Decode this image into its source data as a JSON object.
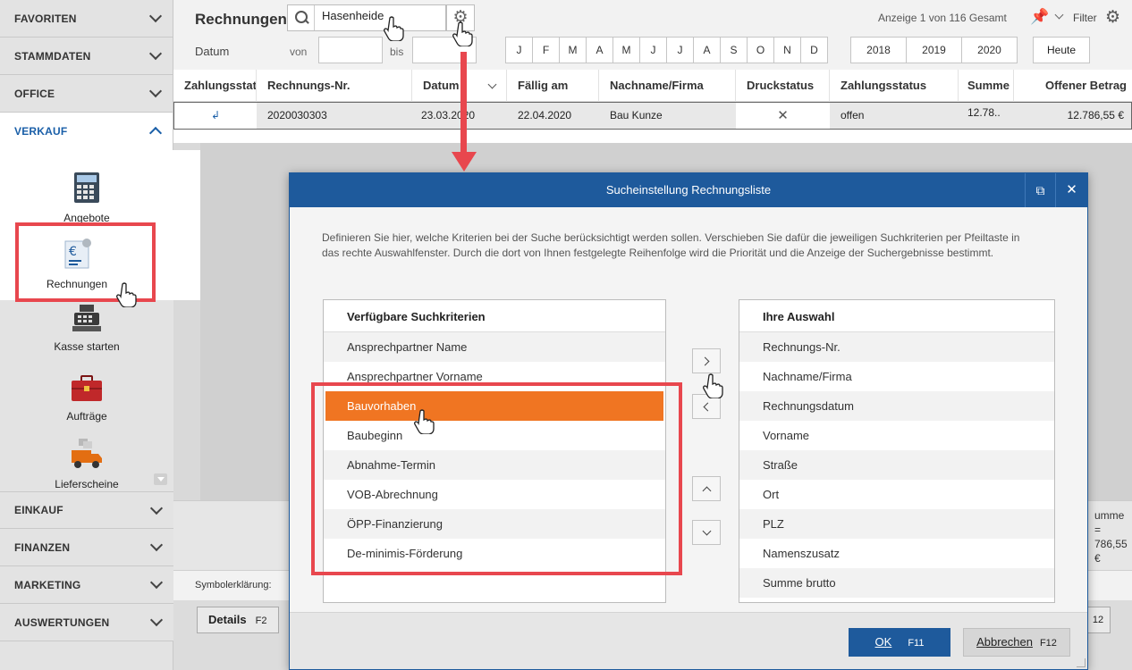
{
  "sidebar": {
    "sections_top": [
      "FAVORITEN",
      "STAMMDATEN",
      "OFFICE"
    ],
    "open_section": "VERKAUF",
    "tiles": [
      {
        "label": "Angebote",
        "icon": "calculator-icon"
      },
      {
        "label": "Rechnungen",
        "icon": "invoice-euro-icon"
      },
      {
        "label": "Kasse starten",
        "icon": "cash-register-icon"
      },
      {
        "label": "Aufträge",
        "icon": "briefcase-icon"
      },
      {
        "label": "Lieferscheine",
        "icon": "delivery-truck-icon"
      }
    ],
    "sections_bottom": [
      "EINKAUF",
      "FINANZEN",
      "MARKETING",
      "AUSWERTUNGEN"
    ]
  },
  "topbar": {
    "title": "Rechnungen",
    "search_value": "Hasenheide",
    "count_text": "Anzeige 1 von 116 Gesamt",
    "filter_label": "Filter",
    "datum_label": "Datum",
    "von_label": "von",
    "bis_label": "bis",
    "months": [
      "J",
      "F",
      "M",
      "A",
      "M",
      "J",
      "J",
      "A",
      "S",
      "O",
      "N",
      "D"
    ],
    "years": [
      "2018",
      "2019",
      "2020"
    ],
    "today_label": "Heute"
  },
  "table": {
    "columns": [
      "Zahlungsstatus",
      "Rechnungs-Nr.",
      "Datum",
      "Fällig am",
      "Nachname/Firma",
      "Druckstatus",
      "Zahlungsstatus",
      "Summe",
      "Offener Betrag"
    ],
    "row": {
      "icon": "↲",
      "nr": "2020030303",
      "datum": "23.03.2020",
      "faellig": "22.04.2020",
      "name": "Bau Kunze",
      "druck": "✕",
      "status": "offen",
      "summe": "12.78..",
      "offen": "12.786,55 €"
    }
  },
  "summary": {
    "line1": "umme =",
    "line2": "786,55 €"
  },
  "symbol_label": "Symbolerklärung:",
  "details_button": {
    "label": "Details",
    "key": "F2"
  },
  "f12_stub": "12",
  "dialog": {
    "title": "Sucheinstellung Rechnungsliste",
    "description": "Definieren Sie hier, welche Kriterien bei der Suche berücksichtigt werden sollen. Verschieben Sie dafür die jeweiligen Suchkriterien per Pfeiltaste in das rechte Auswahlfenster. Durch die dort von Ihnen festgelegte Reihenfolge wird die Priorität und die Anzeige der Suchergebnisse bestimmt.",
    "available_header": "Verfügbare Suchkriterien",
    "available": [
      "Ansprechpartner Name",
      "Ansprechpartner Vorname",
      "Bauvorhaben",
      "Baubeginn",
      "Abnahme-Termin",
      "VOB-Abrechnung",
      "ÖPP-Finanzierung",
      "De-minimis-Förderung"
    ],
    "selected_index": 2,
    "selection_header": "Ihre Auswahl",
    "selection": [
      "Rechnungs-Nr.",
      "Nachname/Firma",
      "Rechnungsdatum",
      "Vorname",
      "Straße",
      "Ort",
      "PLZ",
      "Namenszusatz",
      "Summe brutto"
    ],
    "ok": {
      "label": "OK",
      "key": "F11"
    },
    "cancel": {
      "label": "Abbrechen",
      "key": "F12"
    }
  },
  "colors": {
    "accent_blue": "#1e5a9c",
    "selection_orange": "#f07522",
    "highlight_red": "#e8474e"
  }
}
